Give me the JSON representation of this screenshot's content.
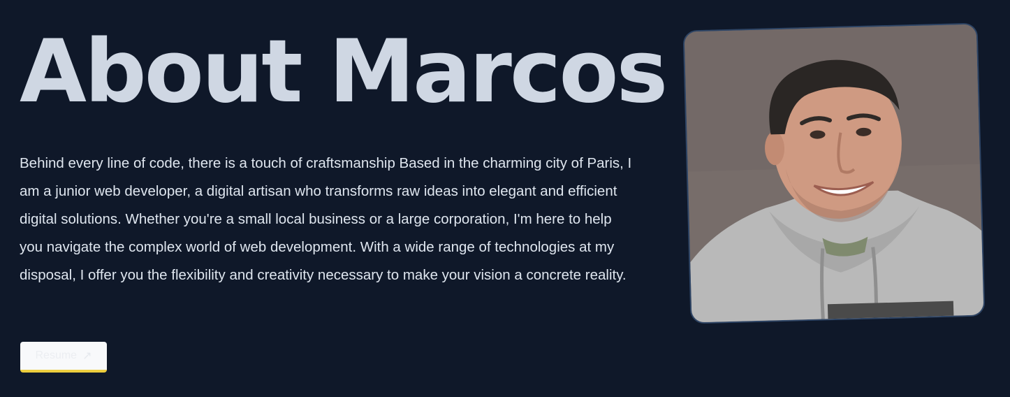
{
  "about": {
    "title": "About Marcos",
    "bio": "Behind every line of code, there is a touch of craftsmanship Based in the charming city of Paris, I am a junior web developer, a digital artisan who transforms raw ideas into elegant and efficient digital solutions. Whether you're a small local business or a large corporation, I'm here to help you navigate the complex world of web development. With a wide range of technologies at my disposal, I offer you the flexibility and creativity necessary to make your vision a concrete reality.",
    "resume_label": "Resume",
    "resume_icon": "arrow-up-right-icon"
  },
  "colors": {
    "background": "#0f1829",
    "title": "#cfd7e3",
    "text": "#dfe6ef",
    "button_bg": "#f8f9fb",
    "button_accent": "#eccd3e",
    "photo_border": "#2e4566"
  }
}
